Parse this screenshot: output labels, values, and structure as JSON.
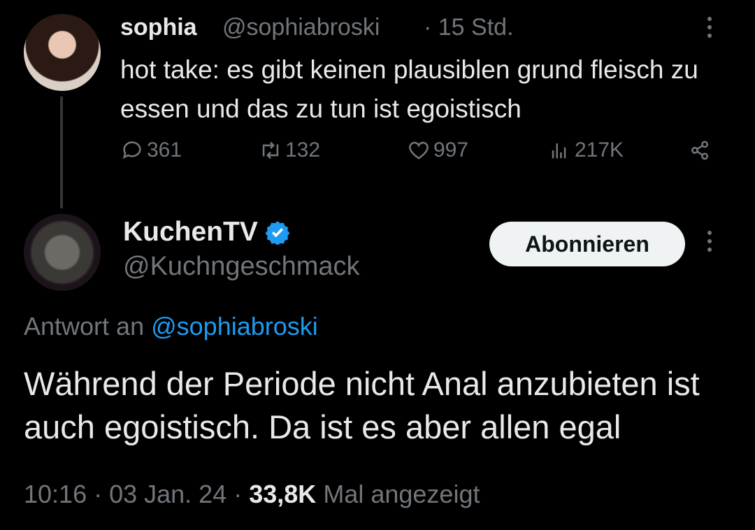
{
  "tweet1": {
    "name": "sophia",
    "handle": "@sophiabroski",
    "time": "· 15 Std.",
    "text": "hot take: es gibt keinen plausiblen grund fleisch zu essen und das zu tun ist egoistisch",
    "replies": "361",
    "retweets": "132",
    "likes": "997",
    "views": "217K"
  },
  "tweet2": {
    "name": "KuchenTV",
    "handle": "@Kuchngeschmack",
    "follow_label": "Abonnieren",
    "reply_prefix": "Antwort an",
    "reply_mention": "@sophiabroski",
    "text": "Während der Periode nicht Anal anzubieten ist auch egoistisch. Da ist es aber allen egal",
    "timestamp": "10:16 · 03 Jan. 24 ·",
    "views_count": "33,8K",
    "views_label": "Mal angezeigt"
  },
  "colors": {
    "background": "#000000",
    "text": "#e7e9ea",
    "muted": "#71767b",
    "accent": "#1d9bf0"
  },
  "icons": [
    "reply-icon",
    "retweet-icon",
    "like-icon",
    "views-icon",
    "share-icon",
    "more-icon",
    "verified-badge-icon"
  ]
}
